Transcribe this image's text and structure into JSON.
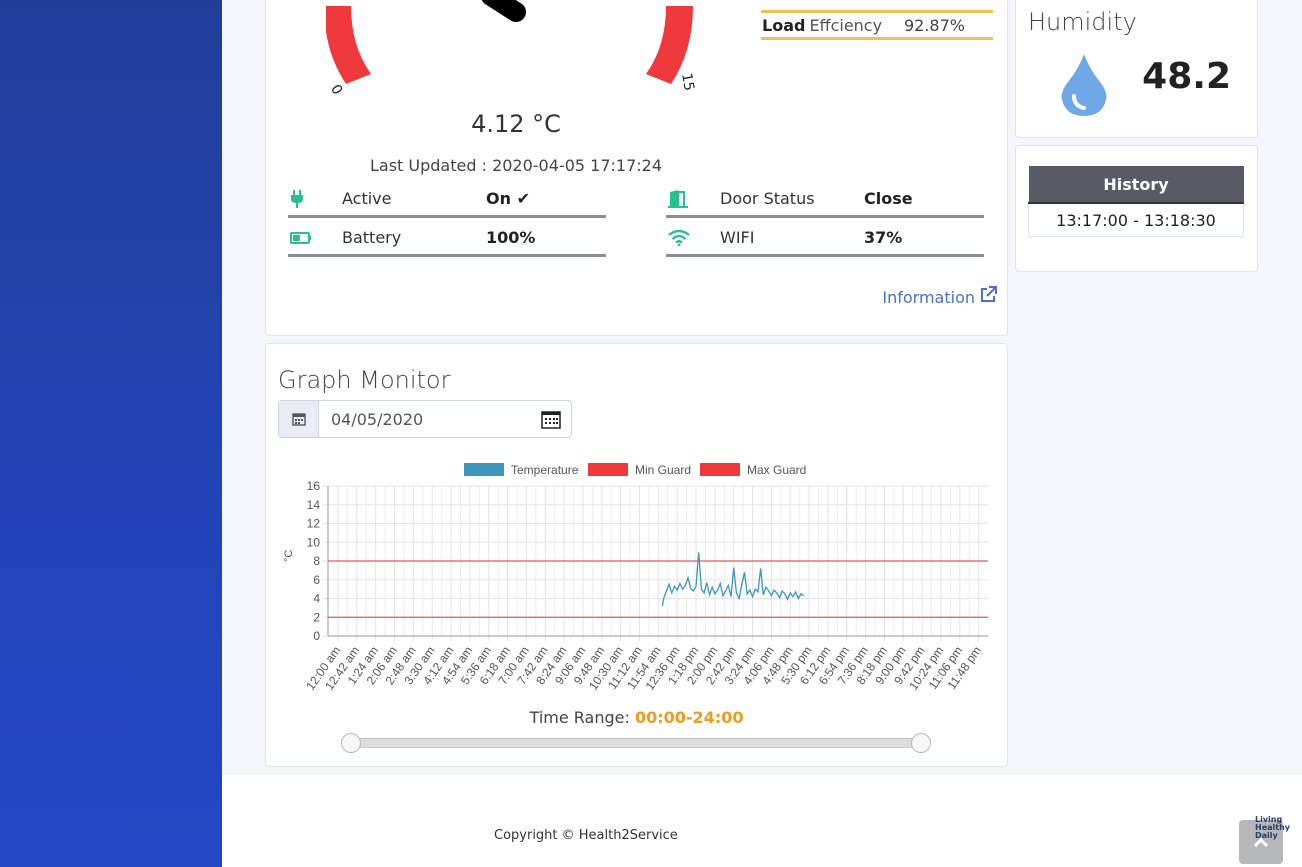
{
  "gauge": {
    "min_label": "0",
    "max_label": "15",
    "temperature": "4.12 °C",
    "last_updated": "Last Updated : 2020-04-05 17:17:24",
    "load_label_bold": "Load",
    "load_label": "Effciency",
    "load_value": "92.87%"
  },
  "status": {
    "active_label": "Active",
    "active_value": "On",
    "battery_label": "Battery",
    "battery_value": "100%",
    "door_label": "Door Status",
    "door_value": "Close",
    "wifi_label": "WIFI",
    "wifi_value": "37%"
  },
  "info_link": "Information",
  "humidity": {
    "title": "Humidity",
    "value": "48.2"
  },
  "history": {
    "header": "History",
    "row": "13:17:00 - 13:18:30"
  },
  "graph": {
    "title": "Graph Monitor",
    "date": "04/05/2020",
    "time_range_label": "Time Range:",
    "time_range_value": "00:00-24:00"
  },
  "chart_data": {
    "type": "line",
    "ylabel": "°C",
    "ylim": [
      0,
      16
    ],
    "yticks": [
      0,
      2,
      4,
      6,
      8,
      10,
      12,
      14,
      16
    ],
    "categories": [
      "12:00 am",
      "12:42 am",
      "1:24 am",
      "2:06 am",
      "2:48 am",
      "3:30 am",
      "4:12 am",
      "4:54 am",
      "5:36 am",
      "6:18 am",
      "7:00 am",
      "7:42 am",
      "8:24 am",
      "9:06 am",
      "9:48 am",
      "10:30 am",
      "11:12 am",
      "11:54 am",
      "12:36 pm",
      "1:18 pm",
      "2:00 pm",
      "2:42 pm",
      "3:24 pm",
      "4:06 pm",
      "4:48 pm",
      "5:30 pm",
      "6:12 pm",
      "6:54 pm",
      "7:36 pm",
      "8:18 pm",
      "9:00 pm",
      "9:42 pm",
      "10:24 pm",
      "11:06 pm",
      "11:48 pm"
    ],
    "legend": [
      "Temperature",
      "Min Guard",
      "Max Guard"
    ],
    "min_guard": 2,
    "max_guard": 8,
    "series": [
      {
        "name": "Temperature",
        "color": "#3e95bd",
        "x_hours": [
          12.05,
          12.1,
          12.2,
          12.3,
          12.4,
          12.5,
          12.6,
          12.7,
          12.8,
          12.9,
          13.0,
          13.1,
          13.2,
          13.3,
          13.4,
          13.5,
          13.6,
          13.7,
          13.8,
          13.9,
          14.0,
          14.1,
          14.2,
          14.3,
          14.4,
          14.5,
          14.6,
          14.7,
          14.8,
          14.9,
          15.0,
          15.1,
          15.2,
          15.3,
          15.4,
          15.5,
          15.6,
          15.7,
          15.8,
          15.9,
          16.0,
          16.1,
          16.2,
          16.3,
          16.4,
          16.5,
          16.6,
          16.7,
          16.8,
          16.9,
          17.0,
          17.1,
          17.2,
          17.3
        ],
        "values": [
          3.2,
          4.0,
          4.8,
          5.5,
          4.6,
          5.3,
          4.9,
          5.6,
          5.0,
          5.4,
          6.2,
          5.1,
          4.8,
          5.3,
          8.9,
          5.0,
          4.6,
          5.7,
          4.4,
          5.2,
          4.5,
          4.9,
          5.6,
          4.3,
          4.8,
          5.4,
          4.2,
          7.3,
          4.6,
          4.0,
          5.5,
          6.8,
          4.5,
          4.9,
          4.2,
          5.0,
          4.7,
          7.2,
          4.4,
          5.2,
          4.8,
          4.3,
          4.9,
          4.6,
          4.1,
          4.8,
          4.5,
          3.9,
          4.6,
          4.2,
          4.7,
          4.0,
          4.5,
          4.3
        ]
      }
    ]
  },
  "footer": {
    "copyright": "Copyright © Health2Service",
    "badge": [
      "Living",
      "Healthy",
      "Daily"
    ]
  },
  "colors": {
    "accent": "#4a6fd1",
    "gauge_red": "#f0393c",
    "status_green": "#27c190",
    "load_line": "#f0c24b",
    "range_orange": "#f29a1c"
  }
}
